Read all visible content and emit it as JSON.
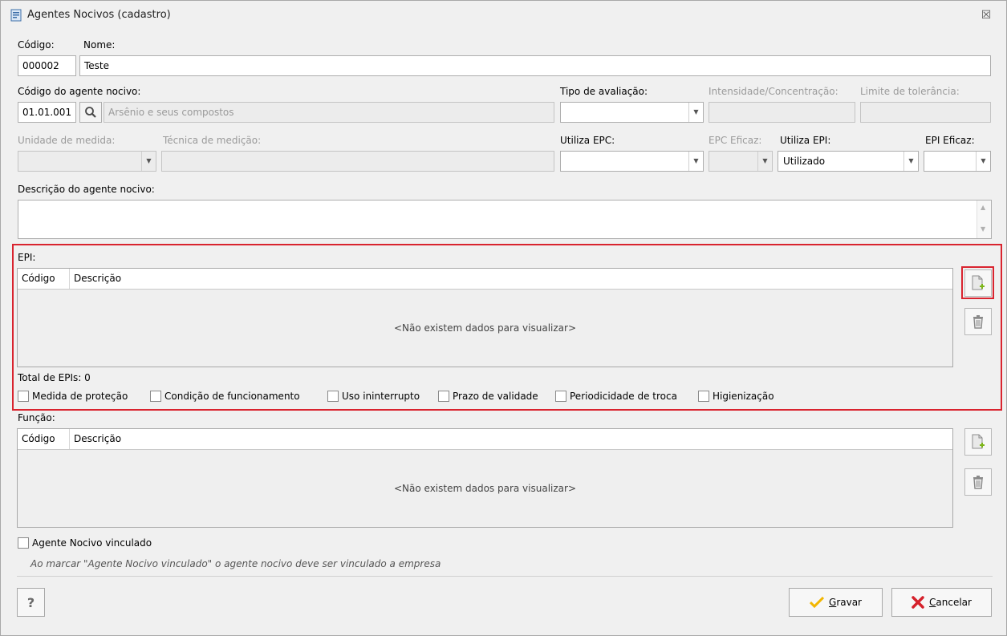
{
  "window": {
    "title": "Agentes Nocivos (cadastro)",
    "close_glyph": "☒"
  },
  "form": {
    "codigo_label": "Código:",
    "codigo_value": "000002",
    "nome_label": "Nome:",
    "nome_value": "Teste",
    "agente_label": "Código do agente nocivo:",
    "agente_codigo": "01.01.001",
    "agente_descricao": "Arsênio e seus compostos",
    "tipo_avaliacao_label": "Tipo de avaliação:",
    "tipo_avaliacao_value": "",
    "intensidade_label": "Intensidade/Concentração:",
    "limite_label": "Limite de tolerância:",
    "unidade_label": "Unidade de medida:",
    "tecnica_label": "Técnica de medição:",
    "utiliza_epc_label": "Utiliza EPC:",
    "utiliza_epc_value": "",
    "epc_eficaz_label": "EPC Eficaz:",
    "utiliza_epi_label": "Utiliza EPI:",
    "utiliza_epi_value": "Utilizado",
    "epi_eficaz_label": "EPI Eficaz:",
    "descricao_label": "Descrição do agente nocivo:",
    "descricao_value": ""
  },
  "epi": {
    "label": "EPI:",
    "columns": [
      "Código",
      "Descrição"
    ],
    "empty_text": "<Não existem dados para visualizar>",
    "total_text": "Total de EPIs: 0",
    "checkboxes": [
      "Medida de proteção",
      "Condição de funcionamento",
      "Uso ininterrupto",
      "Prazo de validade",
      "Periodicidade de troca",
      "Higienização"
    ]
  },
  "funcao": {
    "label": "Função:",
    "columns": [
      "Código",
      "Descrição"
    ],
    "empty_text": "<Não existem dados para visualizar>"
  },
  "vinculado": {
    "label": "Agente Nocivo vinculado",
    "note": "Ao marcar \"Agente Nocivo vinculado\" o agente nocivo deve ser vinculado a empresa"
  },
  "buttons": {
    "help": "?",
    "gravar_first": "G",
    "gravar_rest": "ravar",
    "cancelar_first": "C",
    "cancelar_rest": "ancelar"
  },
  "colors": {
    "highlight": "#d9242f",
    "check": "#f2b600",
    "cancel": "#d5212b"
  },
  "icons": [
    "window-icon",
    "close-icon",
    "search-icon",
    "dropdown-arrow-icon",
    "add-document-icon",
    "trash-icon",
    "help-icon",
    "check-icon",
    "cancel-x-icon"
  ]
}
